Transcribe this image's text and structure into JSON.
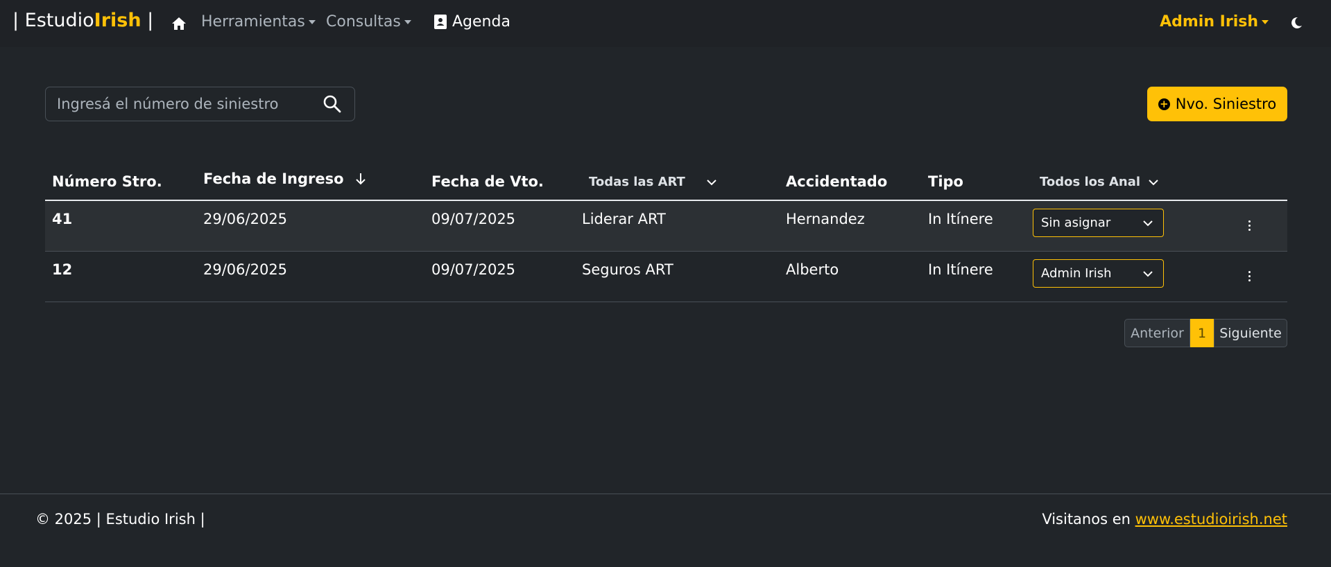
{
  "navbar": {
    "brand_prefix": "| Estudio",
    "brand_accent": "Irish",
    "brand_suffix": " |",
    "home_icon": "home-icon",
    "menu_tools": "Herramientas",
    "menu_queries": "Consultas",
    "agenda_icon": "contact-book-icon",
    "agenda": "Agenda",
    "user": "Admin Irish",
    "theme_icon": "moon-icon"
  },
  "search": {
    "placeholder": "Ingresá el número de siniestro",
    "value": ""
  },
  "new_button": {
    "label": "Nvo. Siniestro",
    "icon": "plus-circle-icon"
  },
  "table": {
    "columns": {
      "number": "Número Stro.",
      "entry_date": "Fecha de Ingreso",
      "due_date": "Fecha de Vto.",
      "art_filter": "Todas las ART",
      "injured": "Accidentado",
      "type": "Tipo",
      "analyst_filter": "Todos los Analis"
    },
    "sort_icon": "arrow-down-icon",
    "rows": [
      {
        "number": "41",
        "entry_date": "29/06/2025",
        "due_date": "09/07/2025",
        "art": "Liderar ART",
        "injured": "Hernandez",
        "type": "In Itínere",
        "analyst": "Sin asignar"
      },
      {
        "number": "12",
        "entry_date": "29/06/2025",
        "due_date": "09/07/2025",
        "art": "Seguros ART",
        "injured": "Alberto",
        "type": "In Itínere",
        "analyst": "Admin Irish"
      }
    ]
  },
  "pagination": {
    "prev": "Anterior",
    "current": "1",
    "next": "Siguiente"
  },
  "footer": {
    "copyright": "© 2025 | Estudio Irish |",
    "visit_text": "Visitanos en ",
    "link": "www.estudioirish.net"
  },
  "colors": {
    "accent": "#ffc107",
    "background": "#212529"
  }
}
